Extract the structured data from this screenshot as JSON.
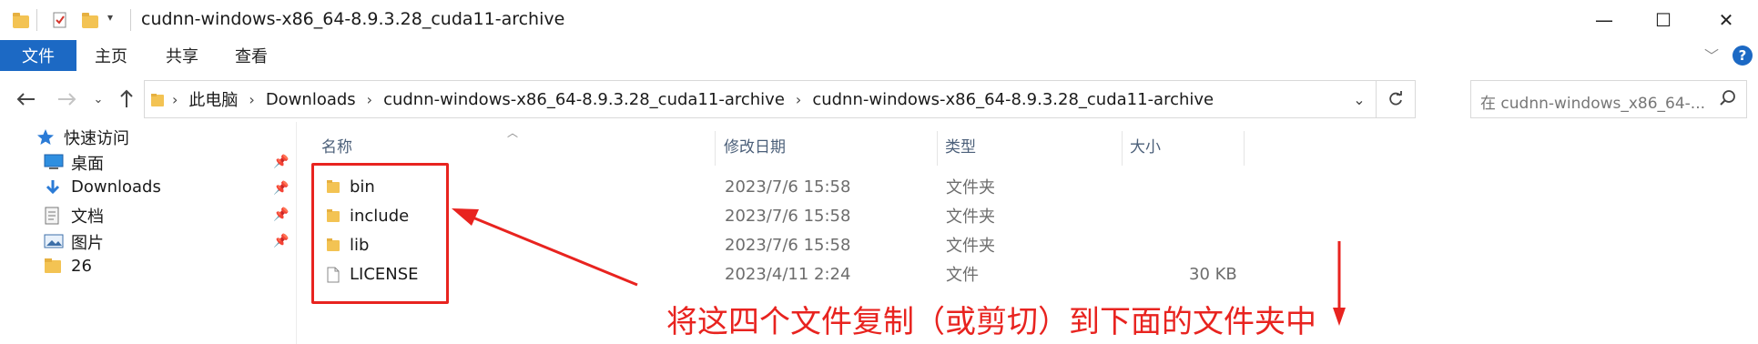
{
  "window": {
    "title": "cudnn-windows-x86_64-8.9.3.28_cuda11-archive",
    "minimize_glyph": "—",
    "maximize_glyph": "☐",
    "close_glyph": "✕"
  },
  "ribbon": {
    "tabs": [
      {
        "label": "文件",
        "active": true
      },
      {
        "label": "主页",
        "active": false
      },
      {
        "label": "共享",
        "active": false
      },
      {
        "label": "查看",
        "active": false
      }
    ],
    "help_label": "?"
  },
  "address": {
    "crumbs": [
      "此电脑",
      "Downloads",
      "cudnn-windows-x86_64-8.9.3.28_cuda11-archive",
      "cudnn-windows-x86_64-8.9.3.28_cuda11-archive"
    ],
    "search_placeholder": "在 cudnn-windows_x86_64-..."
  },
  "nav": {
    "quick_access": "快速访问",
    "items": [
      {
        "label": "桌面",
        "icon": "desktop-icon",
        "pinned": true
      },
      {
        "label": "Downloads",
        "icon": "download-icon",
        "pinned": true
      },
      {
        "label": "文档",
        "icon": "document-icon",
        "pinned": true
      },
      {
        "label": "图片",
        "icon": "pictures-icon",
        "pinned": true
      },
      {
        "label": "26",
        "icon": "folder-icon",
        "pinned": false
      }
    ]
  },
  "columns": {
    "name": "名称",
    "modified": "修改日期",
    "type": "类型",
    "size": "大小"
  },
  "files": [
    {
      "name": "bin",
      "modified": "2023/7/6 15:58",
      "type": "文件夹",
      "size": "",
      "icon": "folder-icon"
    },
    {
      "name": "include",
      "modified": "2023/7/6 15:58",
      "type": "文件夹",
      "size": "",
      "icon": "folder-icon"
    },
    {
      "name": "lib",
      "modified": "2023/7/6 15:58",
      "type": "文件夹",
      "size": "",
      "icon": "folder-icon"
    },
    {
      "name": "LICENSE",
      "modified": "2023/4/11 2:24",
      "type": "文件",
      "size": "30 KB",
      "icon": "file-icon"
    }
  ],
  "annotation": {
    "text": "将这四个文件复制（或剪切）到下面的文件夹中",
    "color": "#e8231f"
  },
  "colors": {
    "accent": "#1c69c4",
    "folder": "#f3c353",
    "annotation": "#e8231f"
  }
}
